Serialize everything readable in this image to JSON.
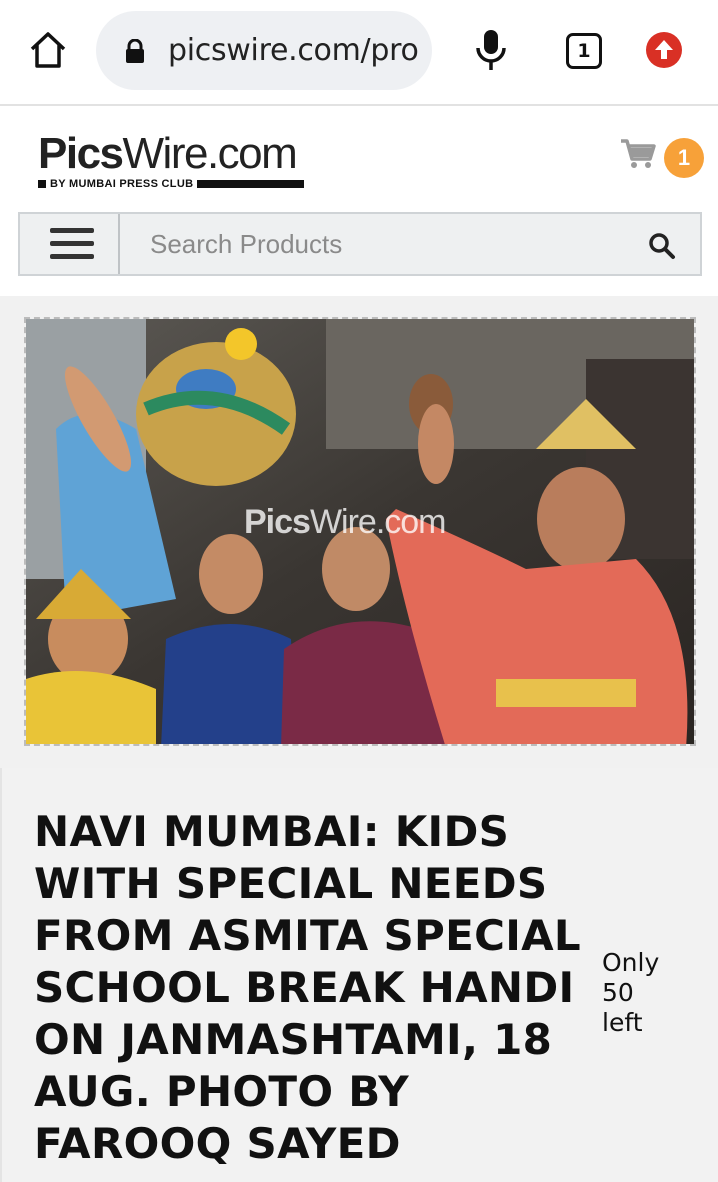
{
  "browser": {
    "url": "picswire.com/pro",
    "tab_count": "1",
    "icons": [
      "home-icon",
      "lock-icon",
      "mic-icon",
      "tabs-icon",
      "update-icon"
    ]
  },
  "site": {
    "logo_bold": "Pics",
    "logo_rest": "Wire.com",
    "logo_tagline": "BY MUMBAI PRESS CLUB",
    "cart_count": "1",
    "search_placeholder": "Search Products",
    "accent_color": "#f7a139"
  },
  "product": {
    "image_watermark_bold": "Pics",
    "image_watermark_rest": "Wire.com",
    "title": "NAVI MUMBAI: KIDS WITH SPECIAL NEEDS FROM ASMITA SPECIAL SCHOOL BREAK HANDI ON JANMASHTAMI, 18 AUG. PHOTO BY FAROOQ SAYED",
    "stock_text": "Only 50 left"
  }
}
